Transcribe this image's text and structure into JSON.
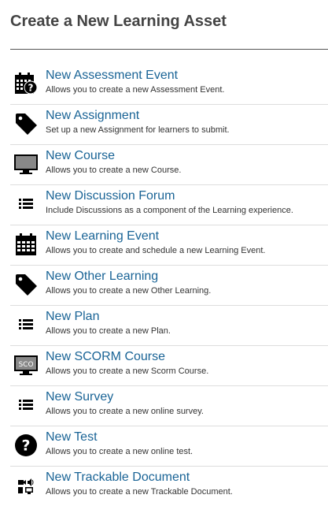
{
  "header": {
    "title": "Create a New Learning Asset"
  },
  "items": [
    {
      "title": "New Assessment Event",
      "description": "Allows you to create a new Assessment Event.",
      "icon": "calendar-question-icon"
    },
    {
      "title": "New Assignment",
      "description": "Set up a new Assignment for learners to submit.",
      "icon": "tag-icon"
    },
    {
      "title": "New Course",
      "description": "Allows you to create a new Course.",
      "icon": "monitor-icon"
    },
    {
      "title": "New Discussion Forum",
      "description": "Include Discussions as a component of the Learning experience.",
      "icon": "list-icon"
    },
    {
      "title": "New Learning Event",
      "description": "Allows you to create and schedule a new Learning Event.",
      "icon": "calendar-icon"
    },
    {
      "title": "New Other Learning",
      "description": "Allows you to create a new Other Learning.",
      "icon": "tag-icon"
    },
    {
      "title": "New Plan",
      "description": "Allows you to create a new Plan.",
      "icon": "list-icon"
    },
    {
      "title": "New SCORM Course",
      "description": "Allows you to create a new Scorm Course.",
      "icon": "sco-monitor-icon",
      "icon_text": "SCO"
    },
    {
      "title": "New Survey",
      "description": "Allows you to create a new online survey.",
      "icon": "list-icon"
    },
    {
      "title": "New Test",
      "description": "Allows you to create a new online test.",
      "icon": "question-circle-icon"
    },
    {
      "title": "New Trackable Document",
      "description": "Allows you to create a new Trackable Document.",
      "icon": "media-icon"
    }
  ]
}
